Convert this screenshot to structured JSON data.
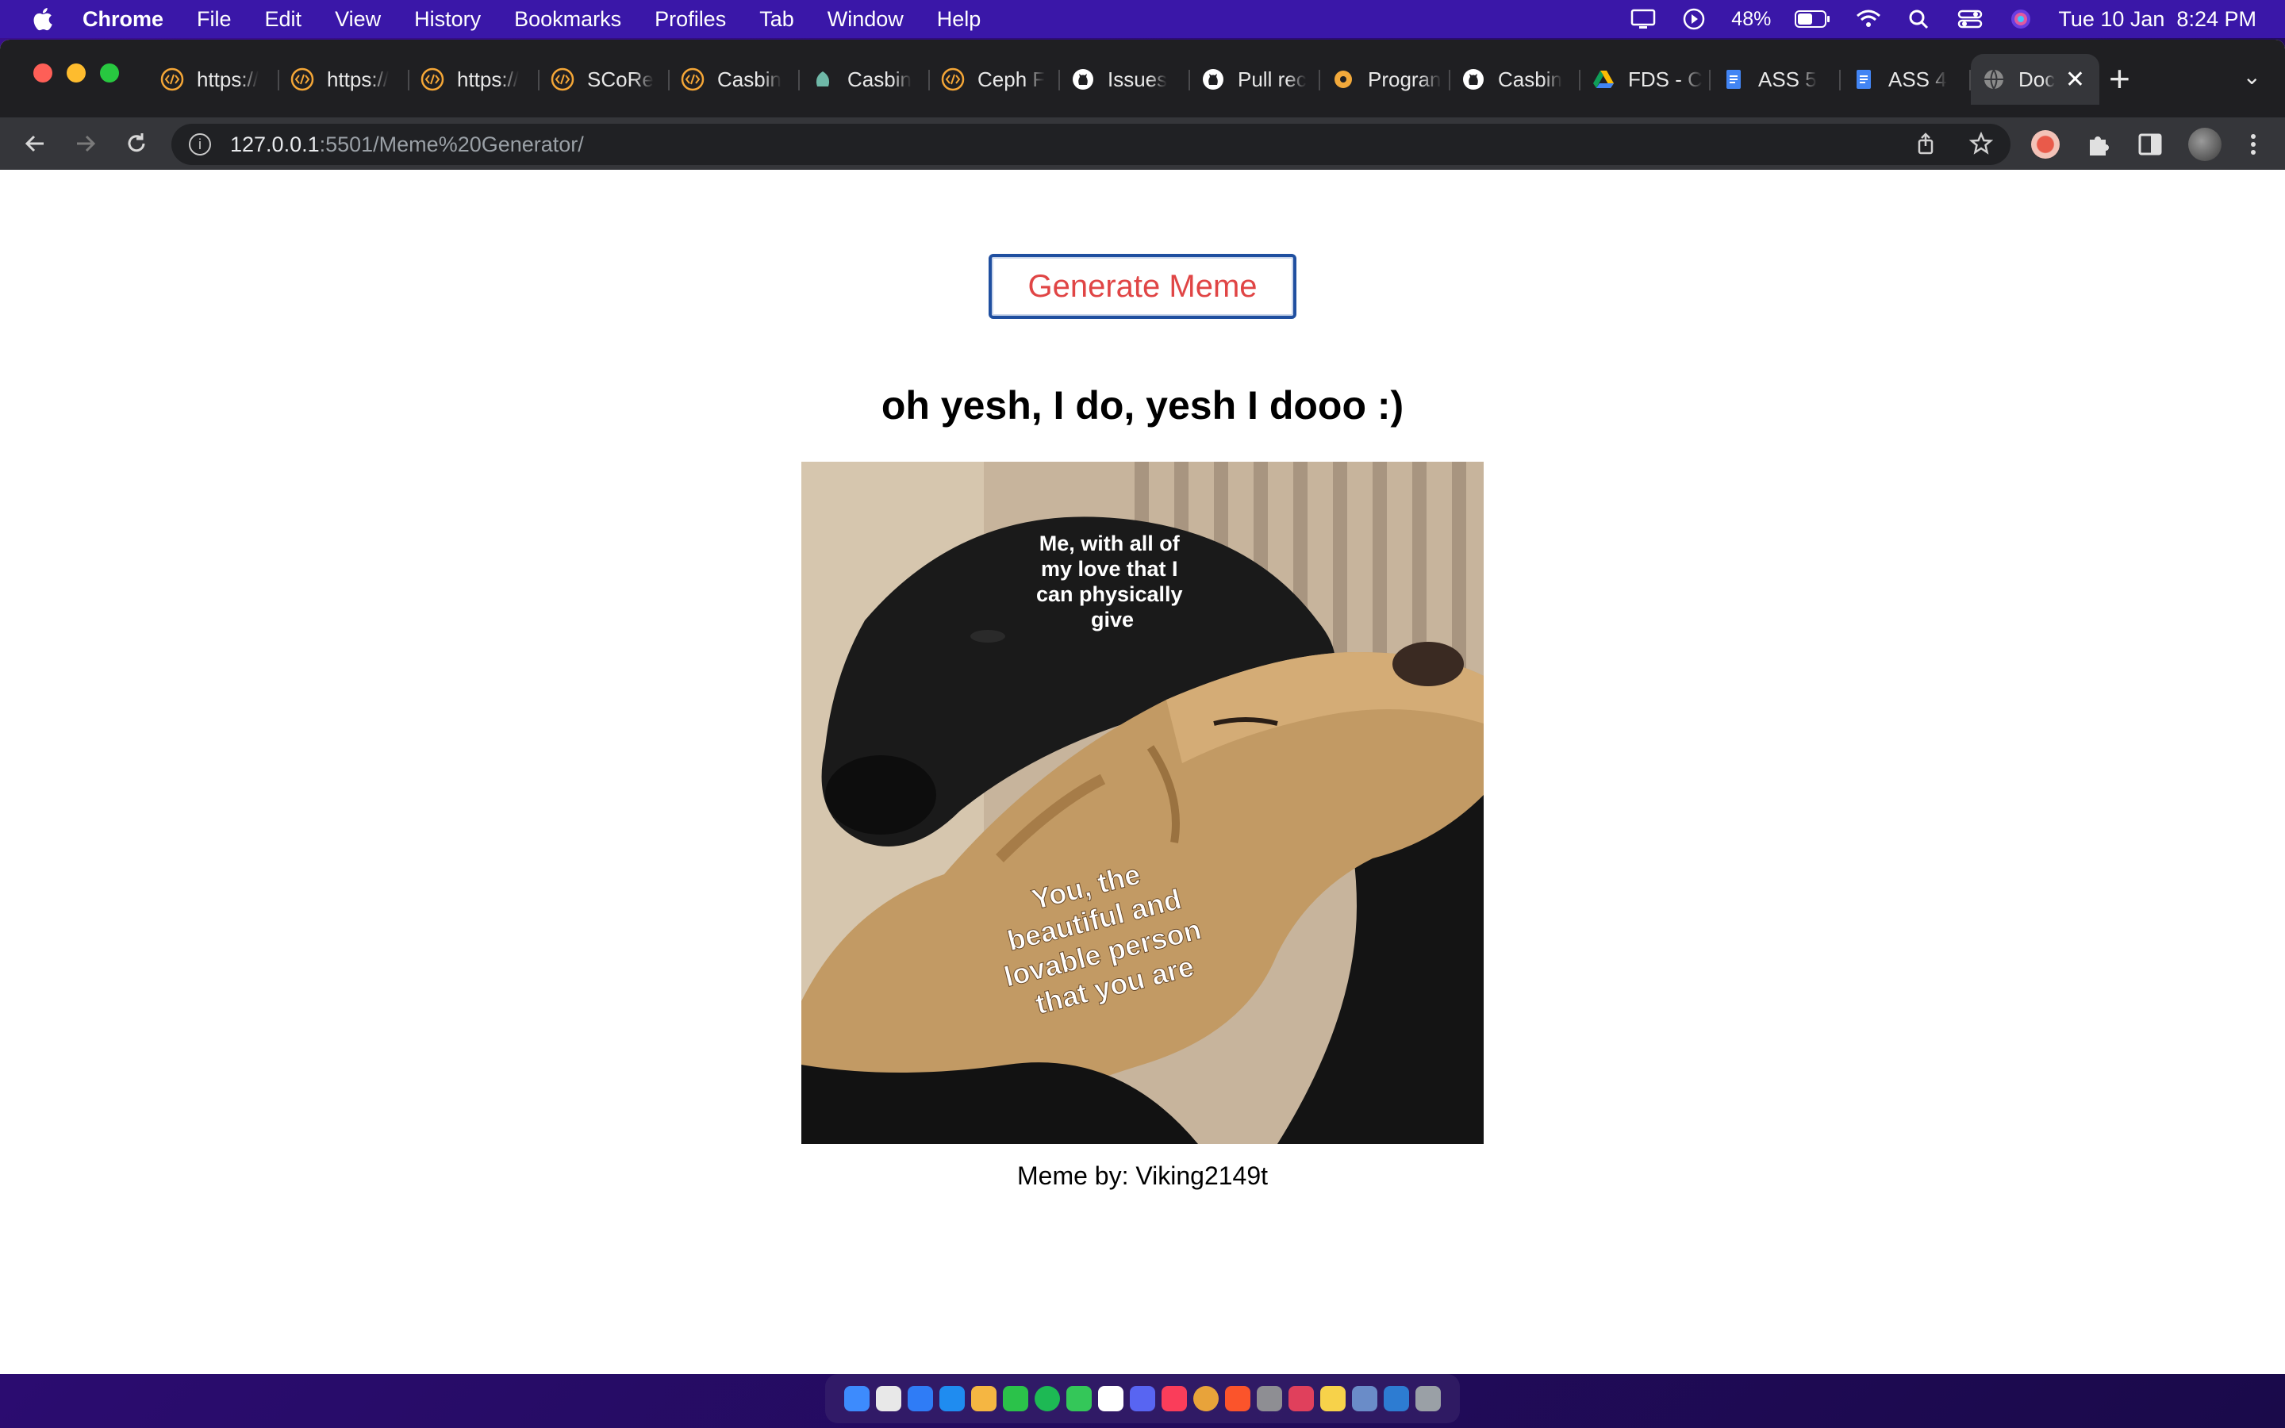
{
  "menubar": {
    "app": "Chrome",
    "items": [
      "File",
      "Edit",
      "View",
      "History",
      "Bookmarks",
      "Profiles",
      "Tab",
      "Window",
      "Help"
    ],
    "battery": "48%",
    "datetime": "Tue 10 Jan  8:24 PM"
  },
  "tabs": [
    {
      "label": "https://",
      "icon": "code-icon"
    },
    {
      "label": "https://",
      "icon": "code-icon"
    },
    {
      "label": "https://",
      "icon": "code-icon"
    },
    {
      "label": "SCoRe",
      "icon": "code-icon"
    },
    {
      "label": "Casbin",
      "icon": "code-icon"
    },
    {
      "label": "Casbin",
      "icon": "casbin-icon"
    },
    {
      "label": "Ceph F",
      "icon": "code-icon"
    },
    {
      "label": "Issues",
      "icon": "github-icon"
    },
    {
      "label": "Pull rec",
      "icon": "github-icon"
    },
    {
      "label": "Progran",
      "icon": "gear-icon"
    },
    {
      "label": "Casbin",
      "icon": "github-icon"
    },
    {
      "label": "FDS - C",
      "icon": "drive-icon"
    },
    {
      "label": "ASS 5",
      "icon": "docs-icon"
    },
    {
      "label": "ASS 4",
      "icon": "docs-icon"
    },
    {
      "label": "Doc",
      "icon": "globe-icon"
    }
  ],
  "address": {
    "host": "127.0.0.1",
    "rest": ":5501/Meme%20Generator/"
  },
  "page": {
    "button_label": "Generate Meme",
    "meme_title": "oh yesh, I do, yesh I dooo :)",
    "meme_top_text": "Me, with all of my love that I can physically give",
    "meme_bottom_text": "You, the beautiful and lovable person that you are",
    "credit": "Meme by: Viking2149t"
  },
  "colors": {
    "button_text": "#e04545",
    "button_border": "#1f4fa0",
    "menubar_bg": "#3a17a8"
  }
}
